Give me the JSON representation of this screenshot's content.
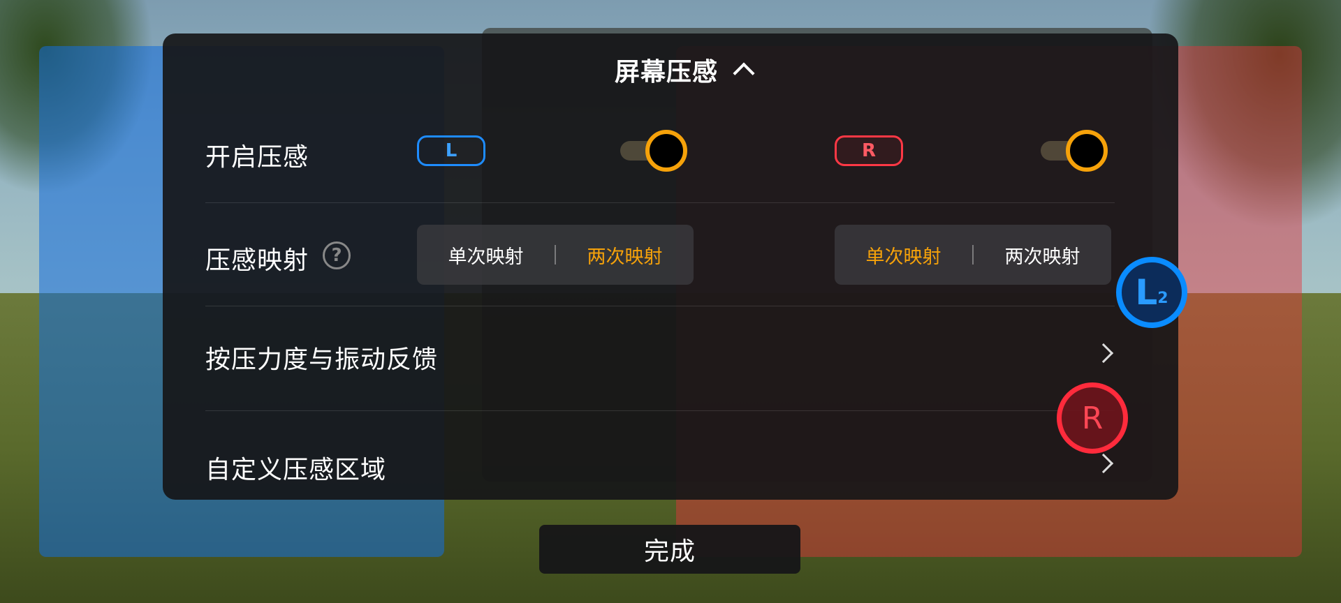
{
  "panel": {
    "title": "屏幕压感",
    "collapse_icon": "chevron-up-icon"
  },
  "rows": {
    "enable": {
      "label": "开启压感",
      "left_badge": "L",
      "right_badge": "R",
      "left_toggle_on": true,
      "right_toggle_on": true
    },
    "mapping": {
      "label": "压感映射",
      "help_icon": "?",
      "left_options": [
        "单次映射",
        "两次映射"
      ],
      "left_selected": "两次映射",
      "right_options": [
        "单次映射",
        "两次映射"
      ],
      "right_selected": "单次映射"
    },
    "force_vibration": {
      "label": "按压力度与振动反馈"
    },
    "custom_area": {
      "label": "自定义压感区域"
    }
  },
  "floating_buttons": {
    "l2_main": "L",
    "l2_sub": "2",
    "r": "R"
  },
  "done_button": "完成",
  "colors": {
    "accent": "#f6a20a",
    "left_blue": "#1e8cff",
    "right_red": "#ff3845"
  }
}
